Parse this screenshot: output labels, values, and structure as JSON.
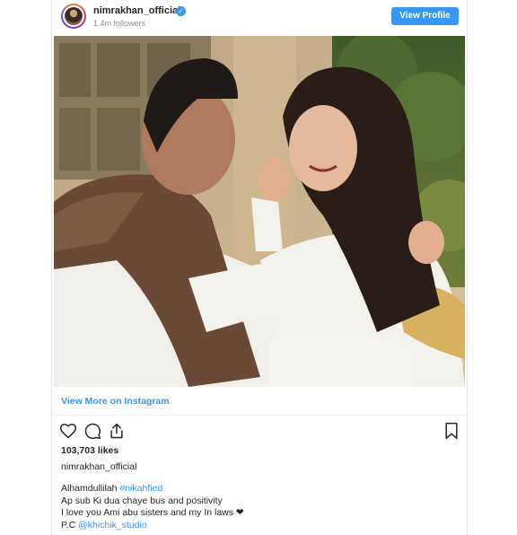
{
  "header": {
    "username": "nimrakhan_official",
    "verified_icon": "verified-badge-icon",
    "followers": "1.4m followers",
    "view_profile_label": "View Profile",
    "accent_color": "#3897f0"
  },
  "post": {
    "photo_description_icon": "photo",
    "view_more_label": "View More on Instagram",
    "likes": "103,703 likes",
    "caption_username": "nimrakhan_official",
    "caption": {
      "line1_text": "Alhamdullilah ",
      "line1_hashtag": "#nikahfied",
      "line2": "Ap sub Ki dua chaye bus and positivity",
      "line3": "I love you Ami abu sisters and my In laws",
      "line3_emoji": "❤",
      "line4_text": "P.C ",
      "line4_mention": "@khichik_studio"
    },
    "actions": {
      "like_icon": "heart-icon",
      "comment_icon": "comment-icon",
      "share_icon": "share-icon",
      "save_icon": "bookmark-icon"
    }
  }
}
